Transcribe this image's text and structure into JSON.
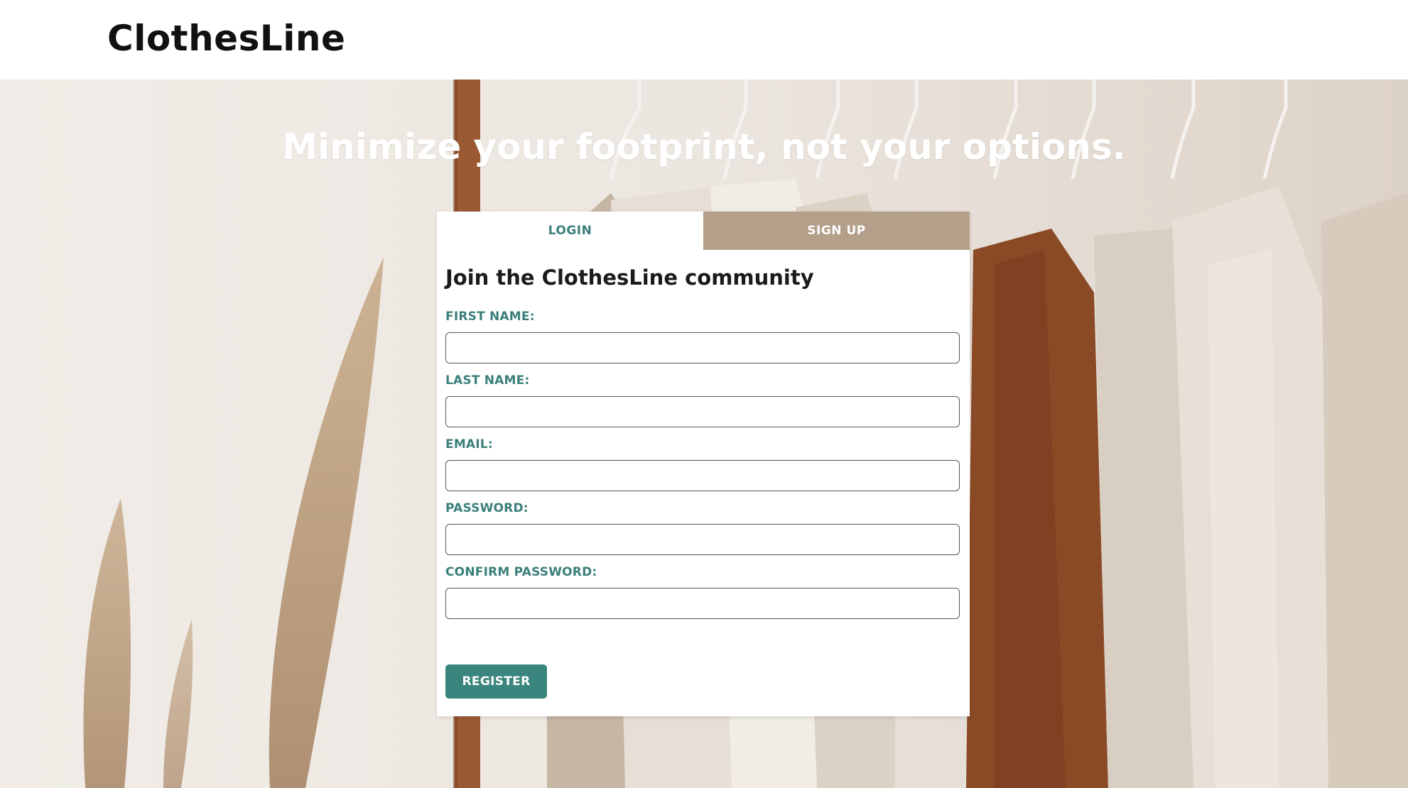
{
  "header": {
    "brand": "ClothesLine"
  },
  "hero": {
    "headline": "Minimize your footprint, not your options."
  },
  "auth": {
    "tabs": [
      {
        "label": "LOGIN",
        "active": false
      },
      {
        "label": "SIGN UP",
        "active": true
      }
    ],
    "title": "Join the ClothesLine community",
    "fields": [
      {
        "label": "FIRST NAME:",
        "value": "",
        "placeholder": ""
      },
      {
        "label": "LAST NAME:",
        "value": "",
        "placeholder": ""
      },
      {
        "label": "EMAIL:",
        "value": "",
        "placeholder": ""
      },
      {
        "label": "PASSWORD:",
        "value": "",
        "placeholder": ""
      },
      {
        "label": "CONFIRM PASSWORD:",
        "value": "",
        "placeholder": ""
      }
    ],
    "submit_label": "REGISTER"
  },
  "colors": {
    "accent": "#3a7f7a",
    "tab_inactive": "#b39f8a",
    "header_bg": "#ffffff"
  }
}
